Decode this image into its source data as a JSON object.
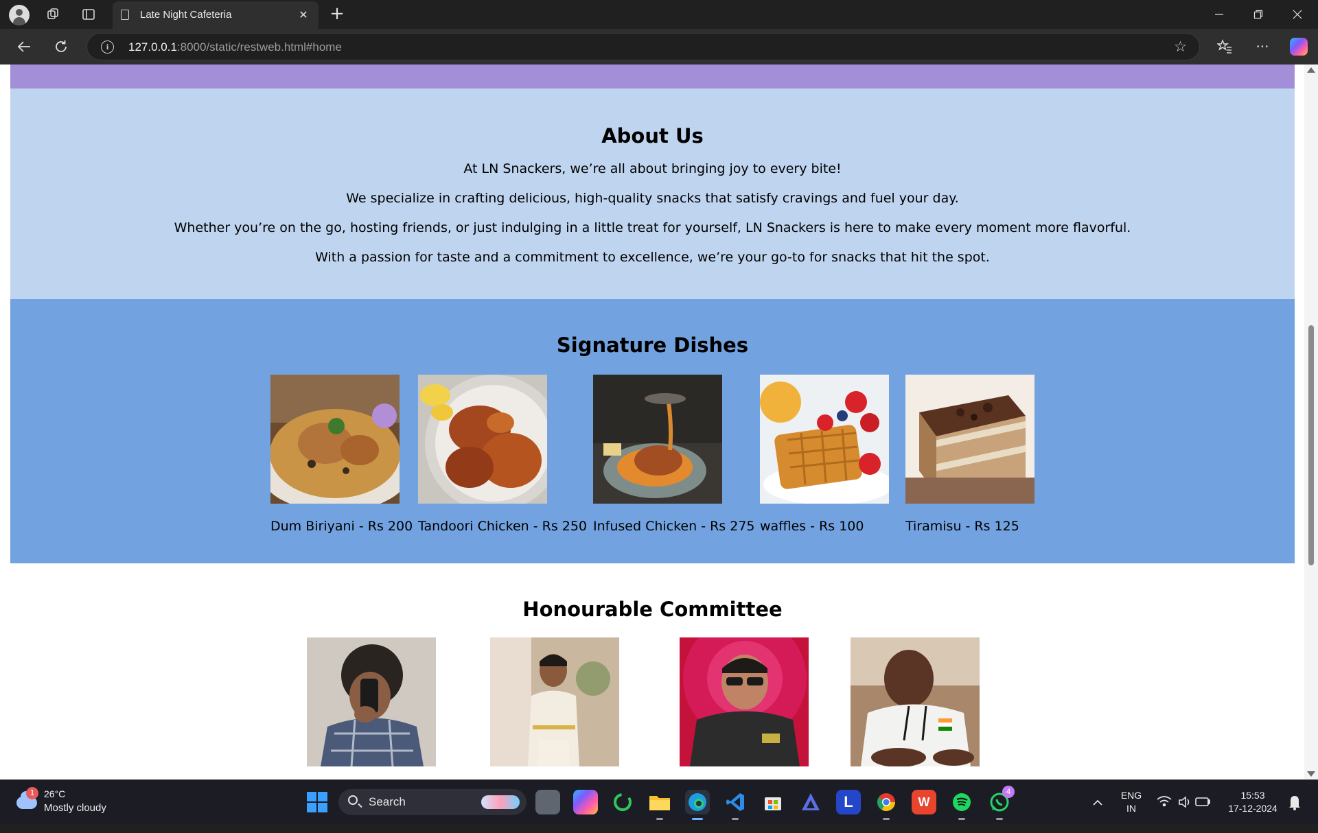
{
  "browser": {
    "tab_title": "Late Night Cafeteria",
    "url_host": "127.0.0.1",
    "url_rest": ":8000/static/restweb.html#home"
  },
  "about": {
    "heading": "About Us",
    "paragraphs": [
      "At LN Snackers, we’re all about bringing joy to every bite!",
      "We specialize in crafting delicious, high-quality snacks that satisfy cravings and fuel your day.",
      "Whether you’re on the go, hosting friends, or just indulging in a little treat for yourself, LN Snackers is here to make every moment more flavorful.",
      "With a passion for taste and a commitment to excellence, we’re your go-to for snacks that hit the spot."
    ]
  },
  "dishes": {
    "heading": "Signature Dishes",
    "items": [
      {
        "caption": "Dum Biriyani - Rs 200"
      },
      {
        "caption": "Tandoori Chicken - Rs 250"
      },
      {
        "caption": "Infused Chicken - Rs 275"
      },
      {
        "caption": "waffles - Rs 100"
      },
      {
        "caption": "Tiramisu - Rs 125"
      }
    ]
  },
  "committee": {
    "heading": "Honourable Committee"
  },
  "taskbar": {
    "weather_badge": "1",
    "temperature": "26°C",
    "condition": "Mostly cloudy",
    "search_label": "Search",
    "whatsapp_badge": "4",
    "lang_line1": "ENG",
    "lang_line2": "IN",
    "time": "15:53",
    "date": "17-12-2024"
  },
  "colors": {
    "nav_strip": "#a38fd8",
    "about_bg": "#bfd4ef",
    "dishes_bg": "#72a2e0",
    "committee_bg": "#ffffff"
  }
}
